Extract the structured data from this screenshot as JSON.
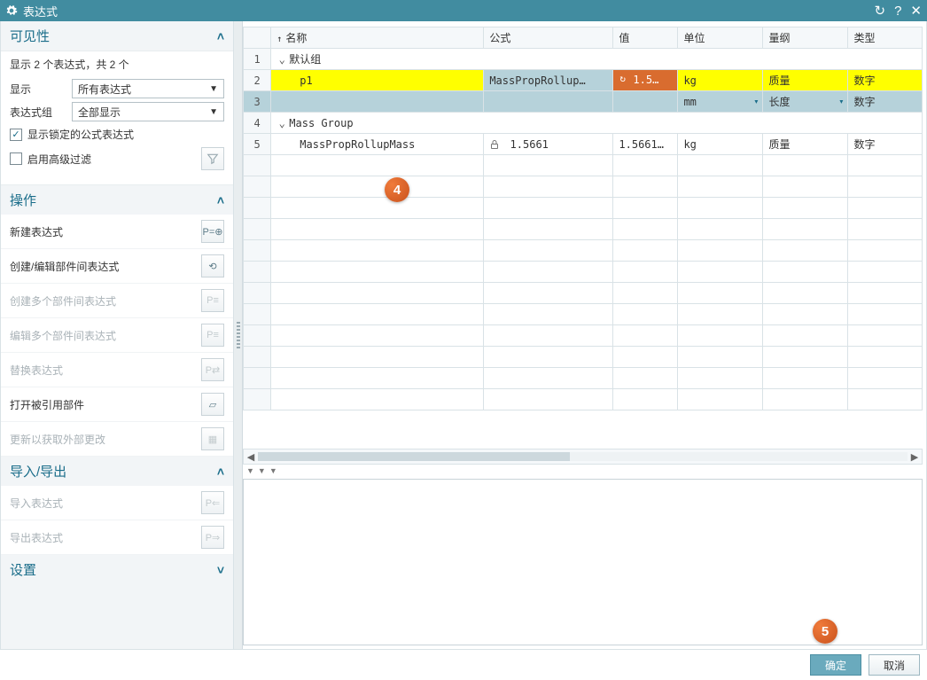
{
  "title": "表达式",
  "titlebar_icons": {
    "refresh": "↻",
    "help": "?",
    "close": "✕"
  },
  "left": {
    "visibility": {
      "header": "可见性",
      "summary": "显示 2 个表达式，共 2 个",
      "show_label": "显示",
      "show_value": "所有表达式",
      "group_label": "表达式组",
      "group_value": "全部显示",
      "lock_checkbox": "显示锁定的公式表达式",
      "lock_checked": "✓",
      "adv_filter": "启用高级过滤"
    },
    "actions": {
      "header": "操作",
      "items": [
        {
          "label": "新建表达式",
          "enabled": true
        },
        {
          "label": "创建/编辑部件间表达式",
          "enabled": true
        },
        {
          "label": "创建多个部件间表达式",
          "enabled": false
        },
        {
          "label": "编辑多个部件间表达式",
          "enabled": false
        },
        {
          "label": "替换表达式",
          "enabled": false
        },
        {
          "label": "打开被引用部件",
          "enabled": true
        },
        {
          "label": "更新以获取外部更改",
          "enabled": false
        }
      ]
    },
    "io": {
      "header": "导入/导出",
      "items": [
        {
          "label": "导入表达式",
          "enabled": false
        },
        {
          "label": "导出表达式",
          "enabled": false
        }
      ]
    },
    "settings": {
      "header": "设置"
    }
  },
  "grid": {
    "columns": {
      "name": "名称",
      "formula": "公式",
      "value": "值",
      "unit": "单位",
      "dimension": "量纲",
      "type": "类型"
    },
    "rows": [
      {
        "num": "1",
        "kind": "group",
        "name": "默认组"
      },
      {
        "num": "2",
        "kind": "highlight",
        "name": "p1",
        "formula": "MassPropRollup…",
        "value": "1.5…",
        "unit": "kg",
        "dimension": "质量",
        "type": "数字"
      },
      {
        "num": "3",
        "kind": "selected",
        "name": "",
        "formula": "",
        "value": "",
        "unit": "mm",
        "dimension": "长度",
        "type": "数字"
      },
      {
        "num": "4",
        "kind": "group",
        "name": "Mass Group"
      },
      {
        "num": "5",
        "kind": "normal",
        "name": "MassPropRollupMass",
        "formula": "1.5661",
        "formula_locked": true,
        "value": "1.5661…",
        "unit": "kg",
        "dimension": "质量",
        "type": "数字"
      }
    ]
  },
  "callouts": {
    "c4": "4",
    "c5": "5"
  },
  "footer": {
    "ok": "确定",
    "cancel": "取消"
  }
}
